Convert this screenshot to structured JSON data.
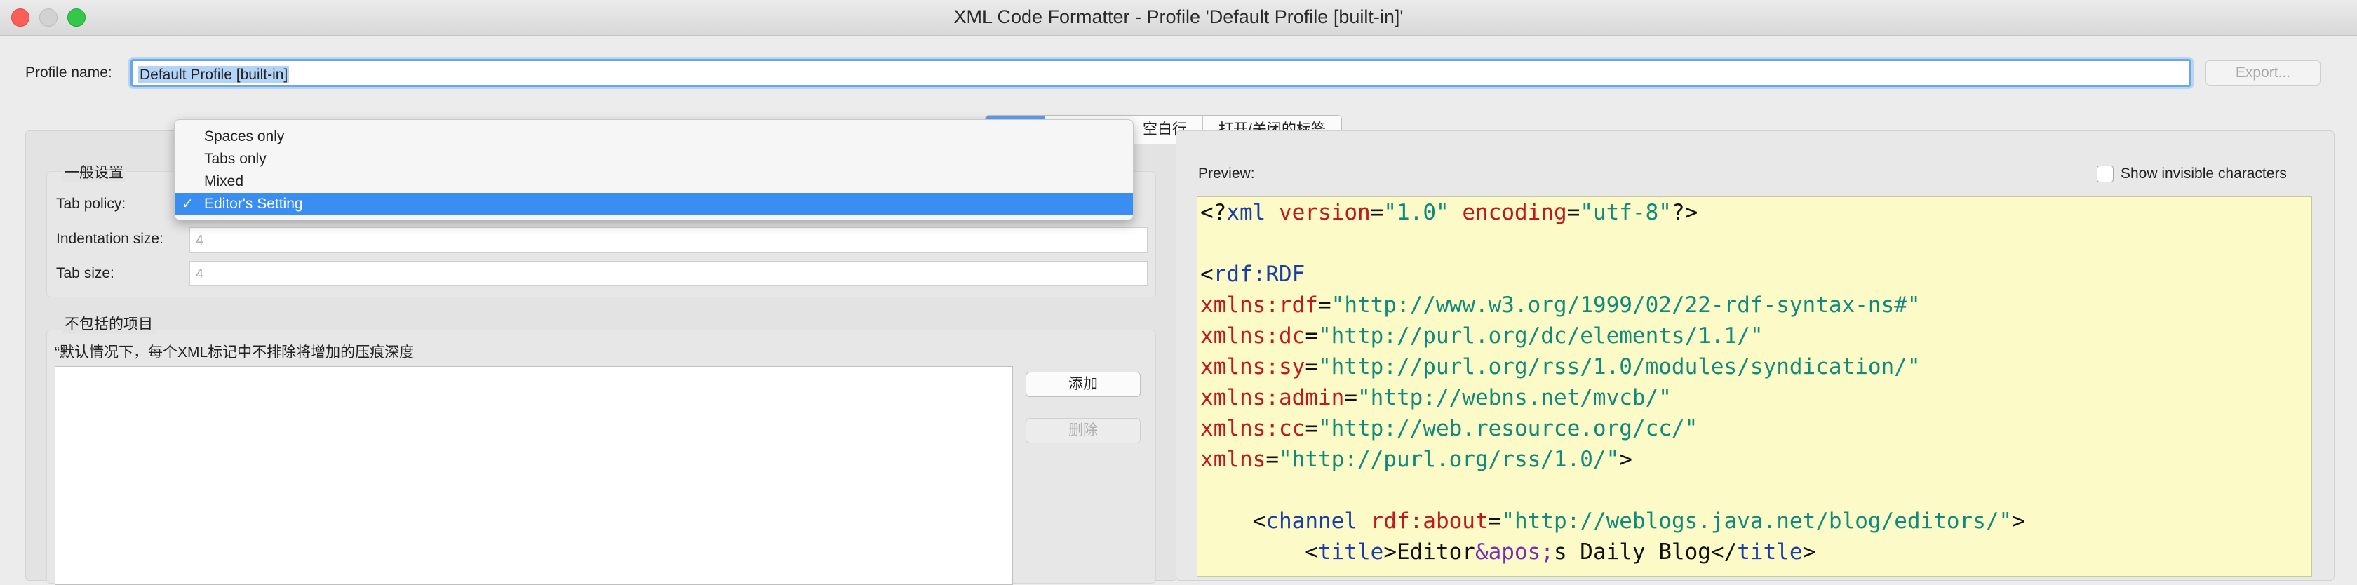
{
  "window": {
    "title": "XML Code Formatter - Profile 'Default Profile [built-in]'"
  },
  "profile": {
    "label": "Profile name:",
    "value": "Default Profile [built-in]",
    "export_label": "Export..."
  },
  "tabs": [
    {
      "label": ""
    },
    {
      "label": ""
    },
    {
      "label": "空白行"
    },
    {
      "label": "打开/关闭的标签"
    }
  ],
  "general": {
    "group_label": "一般设置",
    "tab_policy_label": "Tab policy:",
    "indentation_label": "Indentation size:",
    "indentation_value": "4",
    "tab_size_label": "Tab size:",
    "tab_size_value": "4"
  },
  "tab_policy_menu": {
    "options": [
      "Spaces only",
      "Tabs only",
      "Mixed",
      "Editor's Setting"
    ],
    "selected": "Editor's Setting",
    "check_glyph": "✓"
  },
  "excluded": {
    "group_label": "不包括的项目",
    "description": "“默认情况下，每个XML标记中不排除将增加的压痕深度",
    "add_label": "添加",
    "remove_label": "删除"
  },
  "preview": {
    "label": "Preview:",
    "show_invisible_label": "Show invisible characters",
    "lines": [
      [
        {
          "c": "txt",
          "t": "<?"
        },
        {
          "c": "tag",
          "t": "xml"
        },
        {
          "c": "txt",
          "t": " "
        },
        {
          "c": "attr",
          "t": "version"
        },
        {
          "c": "txt",
          "t": "="
        },
        {
          "c": "val",
          "t": "\"1.0\""
        },
        {
          "c": "txt",
          "t": " "
        },
        {
          "c": "attr",
          "t": "encoding"
        },
        {
          "c": "txt",
          "t": "="
        },
        {
          "c": "val",
          "t": "\"utf-8\""
        },
        {
          "c": "txt",
          "t": "?>"
        }
      ],
      [],
      [
        {
          "c": "txt",
          "t": "<"
        },
        {
          "c": "tag",
          "t": "rdf:RDF"
        }
      ],
      [
        {
          "c": "attr",
          "t": "xmlns:rdf"
        },
        {
          "c": "txt",
          "t": "="
        },
        {
          "c": "val",
          "t": "\"http://www.w3.org/1999/02/22-rdf-syntax-ns#\""
        }
      ],
      [
        {
          "c": "attr",
          "t": "xmlns:dc"
        },
        {
          "c": "txt",
          "t": "="
        },
        {
          "c": "val",
          "t": "\"http://purl.org/dc/elements/1.1/\""
        }
      ],
      [
        {
          "c": "attr",
          "t": "xmlns:sy"
        },
        {
          "c": "txt",
          "t": "="
        },
        {
          "c": "val",
          "t": "\"http://purl.org/rss/1.0/modules/syndication/\""
        }
      ],
      [
        {
          "c": "attr",
          "t": "xmlns:admin"
        },
        {
          "c": "txt",
          "t": "="
        },
        {
          "c": "val",
          "t": "\"http://webns.net/mvcb/\""
        }
      ],
      [
        {
          "c": "attr",
          "t": "xmlns:cc"
        },
        {
          "c": "txt",
          "t": "="
        },
        {
          "c": "val",
          "t": "\"http://web.resource.org/cc/\""
        }
      ],
      [
        {
          "c": "attr",
          "t": "xmlns"
        },
        {
          "c": "txt",
          "t": "="
        },
        {
          "c": "val",
          "t": "\"http://purl.org/rss/1.0/\""
        },
        {
          "c": "txt",
          "t": ">"
        }
      ],
      [],
      [
        {
          "c": "txt",
          "t": "    <"
        },
        {
          "c": "tag",
          "t": "channel"
        },
        {
          "c": "txt",
          "t": " "
        },
        {
          "c": "attr",
          "t": "rdf:about"
        },
        {
          "c": "txt",
          "t": "="
        },
        {
          "c": "val",
          "t": "\"http://weblogs.java.net/blog/editors/\""
        },
        {
          "c": "txt",
          "t": ">"
        }
      ],
      [
        {
          "c": "txt",
          "t": "        <"
        },
        {
          "c": "tag",
          "t": "title"
        },
        {
          "c": "txt",
          "t": ">Editor"
        },
        {
          "c": "ent",
          "t": "&apos;"
        },
        {
          "c": "txt",
          "t": "s Daily Blog</"
        },
        {
          "c": "tag",
          "t": "title"
        },
        {
          "c": "txt",
          "t": ">"
        }
      ]
    ]
  }
}
